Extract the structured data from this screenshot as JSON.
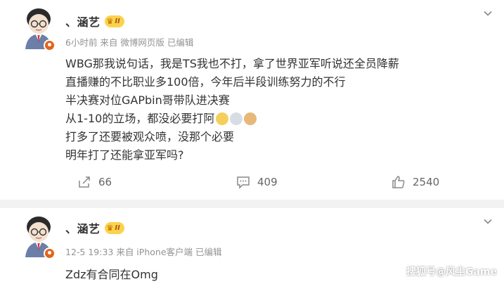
{
  "posts": [
    {
      "author": "、涵艺",
      "vip_level": "II",
      "meta": "6小时前 来自 微博网页版 已编辑",
      "lines": [
        "WBG那我说句话，我是TS我也不打，拿了世界亚军听说还全员降薪",
        "直播赚的不比职业多100倍，今年后半段训练努力的不行",
        "半决赛对位GAPbin哥带队进决赛",
        "从1-10的立场，都没必要打阿",
        "打多了还要被观众喷，没那个必要",
        "明年打了还能拿亚军吗?"
      ],
      "actions": {
        "repost": "66",
        "comment": "409",
        "like": "2540"
      }
    },
    {
      "author": "、涵艺",
      "vip_level": "II",
      "meta": "12-5 19:33 来自 iPhone客户端 已编辑",
      "lines": [
        "Zdz有合同在Omg"
      ]
    }
  ],
  "icons": {
    "chevron": "chevron-down-icon",
    "repost": "repost-icon",
    "comment": "comment-icon",
    "like": "thumbs-up-icon",
    "verified": "verified-badge-icon",
    "vip": "crown-icon"
  },
  "watermark": "搜狐号@风尘Game",
  "colors": {
    "meta": "#939393",
    "vip_bg": "#fcd24b",
    "badge": "#e2651a",
    "text": "#333333"
  }
}
